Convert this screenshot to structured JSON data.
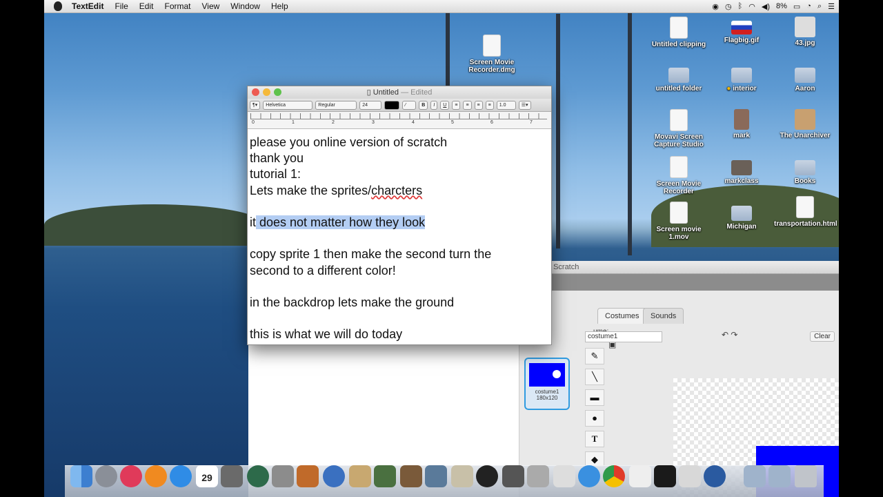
{
  "menubar": {
    "app_name": "TextEdit",
    "items": [
      "File",
      "Edit",
      "Format",
      "View",
      "Window",
      "Help"
    ],
    "battery": "8%"
  },
  "desktop": {
    "icons": [
      {
        "label": "Screen Movie Recorder.dmg"
      },
      {
        "label": "Untitled clipping"
      },
      {
        "label": "Flagbig.gif"
      },
      {
        "label": "43.jpg"
      },
      {
        "label": "untitled folder"
      },
      {
        "label": "interior"
      },
      {
        "label": "Aaron"
      },
      {
        "label": "Movavi Screen Capture Studio"
      },
      {
        "label": "mark"
      },
      {
        "label": "The Unarchiver"
      },
      {
        "label": "Screen Movie Recorder"
      },
      {
        "label": "markclass"
      },
      {
        "label": "Books"
      },
      {
        "label": "Screen movie 1.mov"
      },
      {
        "label": "Michigan"
      },
      {
        "label": "transportation.html"
      }
    ]
  },
  "textedit": {
    "title": "Untitled",
    "status": "— Edited",
    "toolbar": {
      "font_family": "Helvetica",
      "font_style": "Regular",
      "font_size": "24",
      "bold": "B",
      "italic": "I",
      "underline": "U",
      "line_spacing": "1.0"
    },
    "ruler": [
      "0",
      "1",
      "2",
      "3",
      "4",
      "5",
      "6",
      "7"
    ],
    "lines": {
      "l1": "please you online version of scratch",
      "l2": "thank you",
      "l3": "tutorial 1:",
      "l4_a": "Lets make the sprites/",
      "l4_b": "charcters",
      "l5_a": "it",
      "l5_b": " does not matter how they look",
      "l6": "copy sprite 1 then make the second turn the",
      "l7": "second to a different color!",
      "l8": "in the backdrop lets make the ground",
      "l9": "this is what we will do today"
    }
  },
  "scratch": {
    "title": "Untitled-4 on Scratch",
    "tabs": {
      "costumes": "Costumes",
      "sounds": "Sounds"
    },
    "costume_label": "ume:",
    "costume_name_value": "costume1",
    "clear": "Clear",
    "thumb": {
      "name": "costume1",
      "size": "180x120"
    }
  },
  "dock": {
    "calendar_day": "29"
  }
}
